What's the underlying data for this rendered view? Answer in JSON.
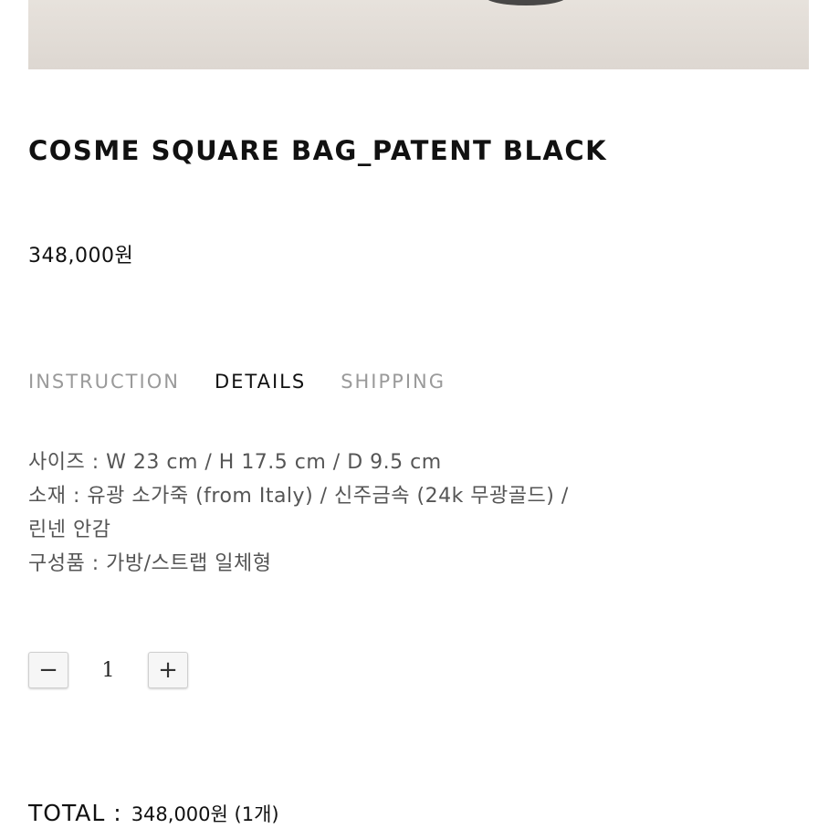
{
  "product": {
    "title": "COSME SQUARE BAG_PATENT BLACK",
    "price": "348,000원"
  },
  "tabs": [
    {
      "label": "INSTRUCTION",
      "active": false
    },
    {
      "label": "DETAILS",
      "active": true
    },
    {
      "label": "SHIPPING",
      "active": false
    }
  ],
  "details": {
    "lines": [
      "사이즈 : W 23 cm / H 17.5 cm / D 9.5 cm",
      "소재 : 유광 소가죽 (from Italy) / 신주금속 (24k 무광골드) /",
      "린넨 안감",
      "구성품 : 가방/스트랩 일체형"
    ]
  },
  "quantity": {
    "minus_label": "−",
    "value": "1",
    "plus_label": "+"
  },
  "total": {
    "label": "TOTAL :",
    "value": "348,000원 (1개)"
  },
  "colors": {
    "text": "#111111",
    "muted_tab": "#9a9a9a",
    "details_text": "#555555",
    "image_bg": "#e3ded8"
  }
}
